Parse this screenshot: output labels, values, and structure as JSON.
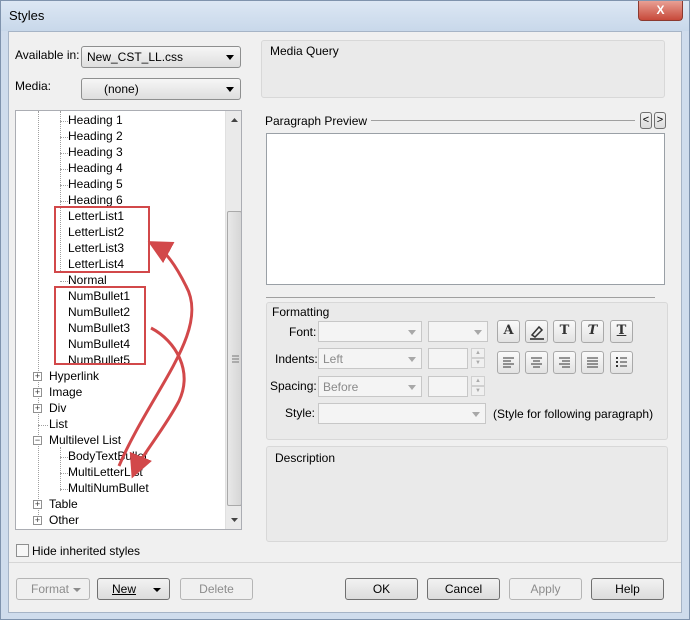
{
  "window": {
    "title": "Styles",
    "close_label": "X"
  },
  "left": {
    "available_in_label": "Available in:",
    "available_in_value": "New_CST_LL.css",
    "media_label": "Media:",
    "media_value": "(none)",
    "hide_inherited_label": "Hide inherited styles"
  },
  "tree": {
    "headings": [
      "Heading 1",
      "Heading 2",
      "Heading 3",
      "Heading 4",
      "Heading 5",
      "Heading 6"
    ],
    "letterlists": [
      "LetterList1",
      "LetterList2",
      "LetterList3",
      "LetterList4"
    ],
    "normal": "Normal",
    "numbullets": [
      "NumBullet1",
      "NumBullet2",
      "NumBullet3",
      "NumBullet4",
      "NumBullet5"
    ],
    "hyperlink": "Hyperlink",
    "image": "Image",
    "div": "Div",
    "list": "List",
    "multilevel": "Multilevel List",
    "multilevel_children": [
      "BodyTextBullet",
      "MultiLetterList",
      "MultiNumBullet"
    ],
    "table": "Table",
    "other": "Other"
  },
  "right": {
    "media_query_label": "Media Query",
    "paragraph_preview_label": "Paragraph Preview",
    "prev_glyph": "<",
    "next_glyph": ">",
    "formatting_label": "Formatting",
    "font_label": "Font:",
    "indents_label": "Indents:",
    "indents_value": "Left",
    "spacing_label": "Spacing:",
    "spacing_value": "Before",
    "style_label": "Style:",
    "style_hint": "(Style for following paragraph)",
    "description_label": "Description"
  },
  "buttons": {
    "format": "Format",
    "new": "New",
    "delete": "Delete",
    "ok": "OK",
    "cancel": "Cancel",
    "apply": "Apply",
    "help": "Help"
  },
  "colors": {
    "annotation": "#d2484a"
  }
}
